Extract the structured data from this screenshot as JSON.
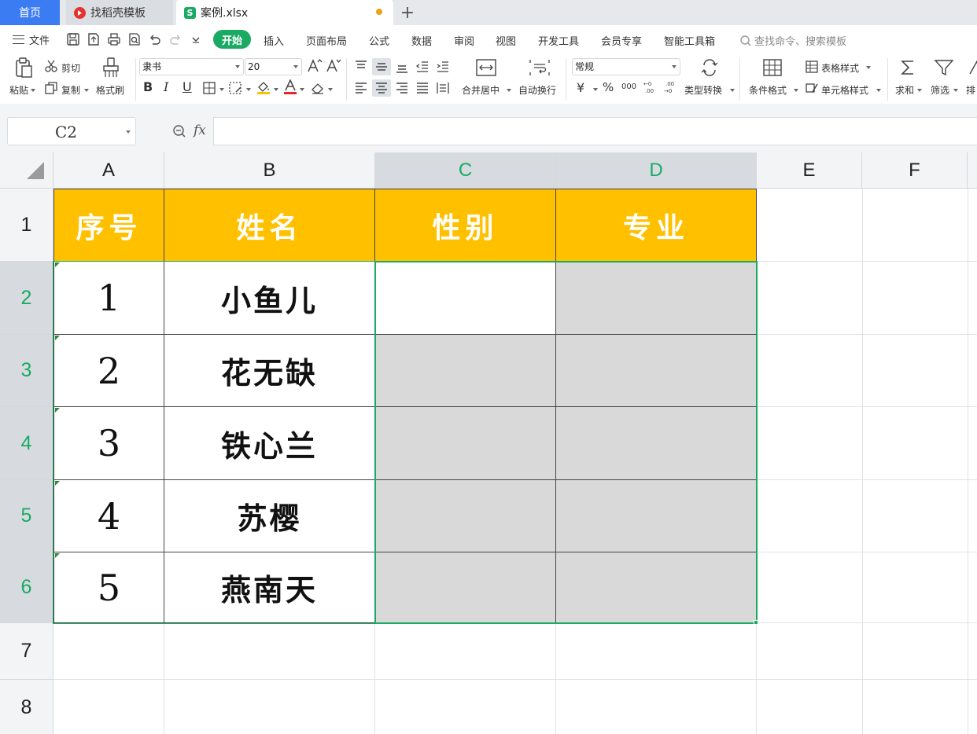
{
  "tabs": {
    "home": "首页",
    "daoke": "找稻壳模板",
    "file": "案例.xlsx",
    "file_icon": "S",
    "add": "+"
  },
  "menu": {
    "file": "文件",
    "items": [
      "开始",
      "插入",
      "页面布局",
      "公式",
      "数据",
      "审阅",
      "视图",
      "开发工具",
      "会员专享",
      "智能工具箱"
    ],
    "search": "查找命令、搜索模板"
  },
  "ribbon": {
    "paste": "粘贴",
    "cut": "剪切",
    "copy": "复制",
    "format_painter": "格式刷",
    "font_name": "隶书",
    "font_size": "20",
    "merge_center": "合并居中",
    "wrap_text": "自动换行",
    "number_format": "常规",
    "currency": "¥",
    "percent": "%",
    "thousands": "000",
    "type_convert": "类型转换",
    "cond_format": "条件格式",
    "table_style": "表格样式",
    "cell_style": "单元格样式",
    "sum": "求和",
    "filter": "筛选",
    "sort": "排"
  },
  "formula_bar": {
    "name_box": "C2",
    "fx": "fx",
    "value": ""
  },
  "sheet": {
    "columns": [
      "A",
      "B",
      "C",
      "D",
      "E",
      "F"
    ],
    "rows": [
      "1",
      "2",
      "3",
      "4",
      "5",
      "6",
      "7",
      "8"
    ],
    "headers": [
      "序号",
      "姓名",
      "性别",
      "专业"
    ],
    "data": [
      {
        "no": "1",
        "name": "小鱼儿"
      },
      {
        "no": "2",
        "name": "花无缺"
      },
      {
        "no": "3",
        "name": "铁心兰"
      },
      {
        "no": "4",
        "name": "苏樱"
      },
      {
        "no": "5",
        "name": "燕南天"
      }
    ],
    "active_cell": "C2",
    "selection": "C2:D6"
  },
  "colors": {
    "accent": "#1aaa63",
    "header_fill": "#ffc000",
    "selection_shade": "#d9d9d9",
    "home_tab": "#3c7cf2"
  }
}
